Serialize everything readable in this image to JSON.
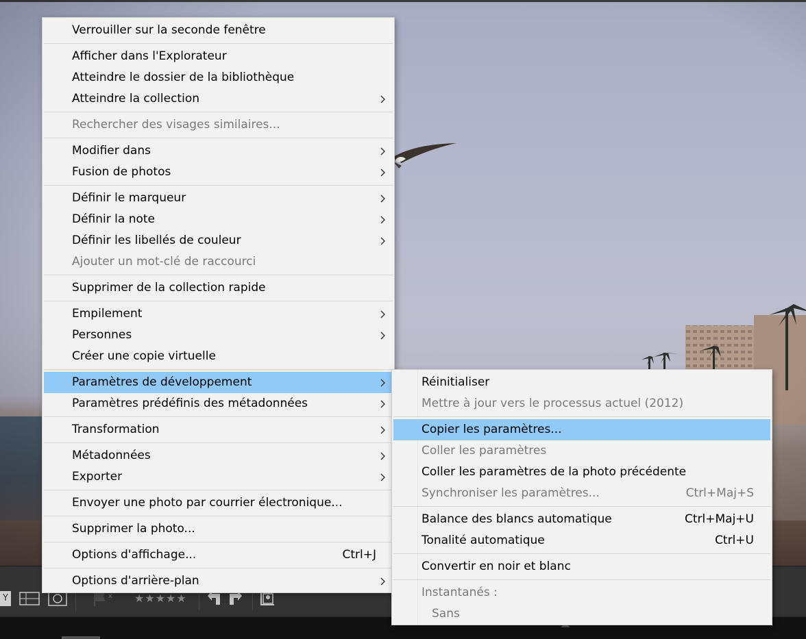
{
  "main_menu": {
    "groups": [
      [
        {
          "label": "Verrouiller sur la seconde fenêtre"
        }
      ],
      [
        {
          "label": "Afficher dans l'Explorateur"
        },
        {
          "label": "Atteindre le dossier de la bibliothèque"
        },
        {
          "label": "Atteindre la collection",
          "submenu": true
        }
      ],
      [
        {
          "label": "Rechercher des visages similaires...",
          "disabled": true
        }
      ],
      [
        {
          "label": "Modifier dans",
          "submenu": true
        },
        {
          "label": "Fusion de photos",
          "submenu": true
        }
      ],
      [
        {
          "label": "Définir le marqueur",
          "submenu": true
        },
        {
          "label": "Définir la note",
          "submenu": true
        },
        {
          "label": "Définir les libellés de couleur",
          "submenu": true
        },
        {
          "label": "Ajouter un mot-clé de raccourci",
          "disabled": true
        }
      ],
      [
        {
          "label": "Supprimer de la collection rapide"
        }
      ],
      [
        {
          "label": "Empilement",
          "submenu": true
        },
        {
          "label": "Personnes",
          "submenu": true
        },
        {
          "label": "Créer une copie virtuelle"
        }
      ],
      [
        {
          "label": "Paramètres de développement",
          "submenu": true,
          "highlighted": true
        },
        {
          "label": "Paramètres prédéfinis des métadonnées",
          "submenu": true
        }
      ],
      [
        {
          "label": "Transformation",
          "submenu": true
        }
      ],
      [
        {
          "label": "Métadonnées",
          "submenu": true
        },
        {
          "label": "Exporter",
          "submenu": true
        }
      ],
      [
        {
          "label": "Envoyer une photo par courrier électronique..."
        }
      ],
      [
        {
          "label": "Supprimer la photo..."
        }
      ],
      [
        {
          "label": "Options d'affichage...",
          "shortcut": "Ctrl+J"
        }
      ],
      [
        {
          "label": "Options d'arrière-plan",
          "submenu": true
        }
      ]
    ]
  },
  "sub_menu": {
    "groups": [
      [
        {
          "label": "Réinitialiser"
        },
        {
          "label": "Mettre à jour vers le processus actuel (2012)",
          "disabled": true
        }
      ],
      [
        {
          "label": "Copier les paramètres...",
          "highlighted": true
        },
        {
          "label": "Coller les paramètres",
          "disabled": true
        },
        {
          "label": "Coller les paramètres de la photo précédente"
        },
        {
          "label": "Synchroniser les paramètres...",
          "shortcut": "Ctrl+Maj+S",
          "disabled": true
        }
      ],
      [
        {
          "label": "Balance des blancs automatique",
          "shortcut": "Ctrl+Maj+U"
        },
        {
          "label": "Tonalité automatique",
          "shortcut": "Ctrl+U"
        }
      ],
      [
        {
          "label": "Convertir en noir et blanc"
        }
      ],
      [
        {
          "label": "Instantanés :",
          "disabled": true
        },
        {
          "label": "Sans",
          "disabled": true,
          "indent": true
        }
      ]
    ]
  },
  "toolbar": {
    "left_letter": "Y",
    "stars": "★★★★★",
    "icons": [
      "grid-view-icon",
      "people-icon",
      "flag-icon",
      "rotate-left-icon",
      "rotate-right-icon",
      "crop-person-icon"
    ]
  },
  "colors": {
    "menu_bg": "#f2f2f2",
    "highlight": "#91c9f7",
    "disabled_text": "#7a7a7a"
  }
}
